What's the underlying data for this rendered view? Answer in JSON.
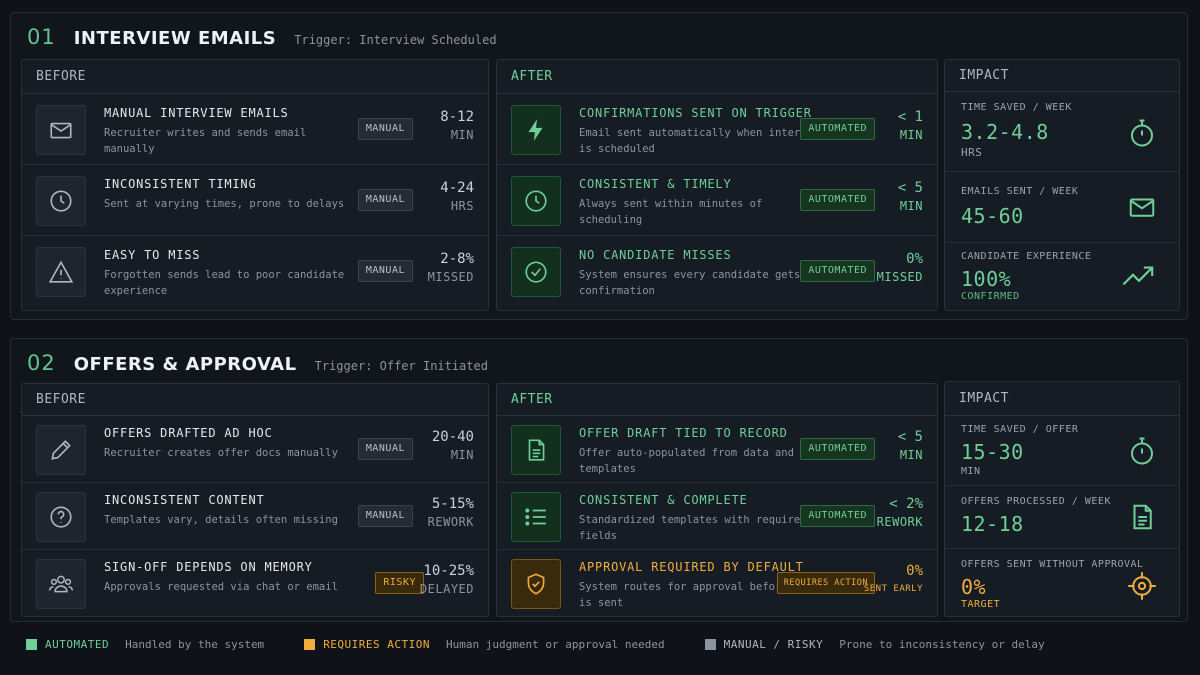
{
  "section1": {
    "number": "01",
    "title": "INTERVIEW EMAILS",
    "trigger": "Trigger: Interview Scheduled",
    "before_title": "BEFORE",
    "after_title": "AFTER",
    "impact_title": "IMPACT",
    "before": [
      {
        "icon": "mail-icon",
        "title": "MANUAL INTERVIEW EMAILS",
        "desc": "Recruiter writes and sends email manually",
        "badge": "MANUAL",
        "value": "8-12",
        "unit": "MIN"
      },
      {
        "icon": "clock-icon",
        "title": "INCONSISTENT TIMING",
        "desc": "Sent at varying times, prone to delays",
        "badge": "MANUAL",
        "value": "4-24",
        "unit": "HRS"
      },
      {
        "icon": "warning-icon",
        "title": "EASY TO MISS",
        "desc": "Forgotten sends lead to poor candidate experience",
        "badge": "MANUAL",
        "value": "2-8%",
        "unit": "MISSED"
      }
    ],
    "after": [
      {
        "icon": "bolt-icon",
        "title": "CONFIRMATIONS SENT ON TRIGGER",
        "desc": "Email sent automatically when interview is scheduled",
        "badge": "AUTOMATED",
        "value": "< 1",
        "unit": "MIN"
      },
      {
        "icon": "clock-icon",
        "title": "CONSISTENT & TIMELY",
        "desc": "Always sent within minutes of scheduling",
        "badge": "AUTOMATED",
        "value": "< 5",
        "unit": "MIN"
      },
      {
        "icon": "check-circle-icon",
        "title": "NO CANDIDATE MISSES",
        "desc": "System ensures every candidate gets a confirmation",
        "badge": "AUTOMATED",
        "value": "0%",
        "unit": "MISSED"
      }
    ],
    "impact": [
      {
        "label": "TIME SAVED / WEEK",
        "value": "3.2-4.8",
        "unit": "HRS",
        "icon": "stopwatch-icon"
      },
      {
        "label": "EMAILS SENT / WEEK",
        "value": "45-60",
        "unit": "",
        "icon": "mail-icon"
      },
      {
        "label": "CANDIDATE EXPERIENCE",
        "value": "100%",
        "unit": "CONFIRMED",
        "icon": "trend-up-icon"
      }
    ]
  },
  "section2": {
    "number": "02",
    "title": "OFFERS & APPROVAL",
    "trigger": "Trigger: Offer Initiated",
    "before_title": "BEFORE",
    "after_title": "AFTER",
    "impact_title": "IMPACT",
    "before": [
      {
        "icon": "pencil-icon",
        "title": "OFFERS DRAFTED AD HOC",
        "desc": "Recruiter creates offer docs manually",
        "badge": "MANUAL",
        "value": "20-40",
        "unit": "MIN"
      },
      {
        "icon": "question-icon",
        "title": "INCONSISTENT CONTENT",
        "desc": "Templates vary, details often missing",
        "badge": "MANUAL",
        "value": "5-15%",
        "unit": "REWORK"
      },
      {
        "icon": "people-icon",
        "title": "SIGN-OFF DEPENDS ON MEMORY",
        "desc": "Approvals requested via chat or email",
        "badge": "RISKY",
        "value": "10-25%",
        "unit": "DELAYED"
      }
    ],
    "after": [
      {
        "icon": "document-icon",
        "title": "OFFER DRAFT TIED TO RECORD",
        "desc": "Offer auto-populated from data and templates",
        "badge": "AUTOMATED",
        "value": "< 5",
        "unit": "MIN"
      },
      {
        "icon": "list-icon",
        "title": "CONSISTENT & COMPLETE",
        "desc": "Standardized templates with required fields",
        "badge": "AUTOMATED",
        "value": "< 2%",
        "unit": "REWORK"
      },
      {
        "icon": "shield-check-icon",
        "title": "APPROVAL REQUIRED BY DEFAULT",
        "desc": "System routes for approval before offer is sent",
        "badge": "REQUIRES ACTION",
        "value": "0%",
        "unit": "SENT EARLY"
      }
    ],
    "impact": [
      {
        "label": "TIME SAVED / OFFER",
        "value": "15-30",
        "unit": "MIN",
        "icon": "stopwatch-icon"
      },
      {
        "label": "OFFERS PROCESSED / WEEK",
        "value": "12-18",
        "unit": "",
        "icon": "document-icon"
      },
      {
        "label": "OFFERS SENT WITHOUT APPROVAL",
        "value": "0%",
        "unit": "TARGET",
        "icon": "target-icon"
      }
    ]
  },
  "legend": [
    {
      "name": "AUTOMATED",
      "desc": "Handled by the system",
      "color": "#6fcf97"
    },
    {
      "name": "REQUIRES ACTION",
      "desc": "Human judgment or approval needed",
      "color": "#f0ad3c"
    },
    {
      "name": "MANUAL / RISKY",
      "desc": "Prone to inconsistency or delay",
      "color": "#8b949e"
    }
  ],
  "colors": {
    "automated": "#6fcf97",
    "action": "#f0ad3c",
    "manual": "#8b949e",
    "background": "#0f1319"
  }
}
